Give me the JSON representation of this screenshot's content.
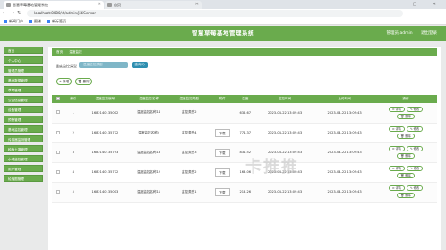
{
  "browser": {
    "tabs": [
      {
        "title": "智慧草莓基地管理系统"
      },
      {
        "title": "首页"
      }
    ],
    "address": "localhost:8080/#/admin/jidiSensor",
    "bookmarks": [
      "新闻门户",
      "图谱",
      "新标签页"
    ],
    "window_controls": "– ▢ ✕"
  },
  "header": {
    "title": "智慧草莓基地管理系统",
    "user": "管理员 admin",
    "logout": "退出登录"
  },
  "sidebar": {
    "items": [
      {
        "label": "首页"
      },
      {
        "label": "个人中心"
      },
      {
        "label": "管理员管理"
      },
      {
        "label": "基地数据管理"
      },
      {
        "label": "草莓管理"
      },
      {
        "label": "公告信息管理"
      },
      {
        "label": "设备管理"
      },
      {
        "label": "预警管理"
      },
      {
        "label": "基地监控管理"
      },
      {
        "label": "传感器监测管理"
      },
      {
        "label": "种植土壤管理"
      },
      {
        "label": "水域监控管理"
      },
      {
        "label": "用户管理"
      },
      {
        "label": "轮播图管理"
      }
    ]
  },
  "breadcrumb": {
    "home": "首页",
    "current": "温度监控"
  },
  "search": {
    "label": "温度监控类型",
    "placeholder": "温度监控类型",
    "button": "查询 Q"
  },
  "actions": {
    "add": "+ 新增",
    "delete": "🗑 删除"
  },
  "table": {
    "columns": [
      "",
      "索引",
      "温度监控编号",
      "温度监控名称",
      "温度监控类型",
      "附件",
      "温度",
      "监控时间",
      "上传时间",
      "操作"
    ],
    "rows": [
      {
        "idx": "1",
        "code": "1682140135002",
        "name": "温度监控名称14",
        "type": "监控类型2",
        "file": "",
        "temp": "636.67",
        "mtime": "2023-04-22 13:09:43",
        "utime": "2023-04-22 13:09:43"
      },
      {
        "idx": "2",
        "code": "1682140135772",
        "name": "温度监控名称4",
        "type": "监控类型4",
        "file": "下载",
        "temp": "774.37",
        "mtime": "2023-04-22 13:09:43",
        "utime": "2023-04-22 13:09:43"
      },
      {
        "idx": "3",
        "code": "1682140135793",
        "name": "温度监控名称13",
        "type": "监控类型3",
        "file": "下载",
        "temp": "831.52",
        "mtime": "2023-04-22 13:09:43",
        "utime": "2023-04-22 13:09:43"
      },
      {
        "idx": "4",
        "code": "1682140135772",
        "name": "温度监控名称12",
        "type": "监控类型2",
        "file": "下载",
        "temp": "163.06",
        "mtime": "2023-04-22 13:09:43",
        "utime": "2023-04-22 13:09:43"
      },
      {
        "idx": "5",
        "code": "1682140135003",
        "name": "温度监控名称11",
        "type": "监控类型1",
        "file": "下载",
        "temp": "213.26",
        "mtime": "2023-04-22 13:09:43",
        "utime": "2023-04-22 13:09:43"
      }
    ],
    "row_actions": {
      "detail": "⊙ 详情",
      "edit": "✎ 修改",
      "delete": "🗑 删除"
    }
  },
  "watermark": "卡推推",
  "colors": {
    "primary": "#6aab4d",
    "search_btn": "#2f8fb0"
  }
}
